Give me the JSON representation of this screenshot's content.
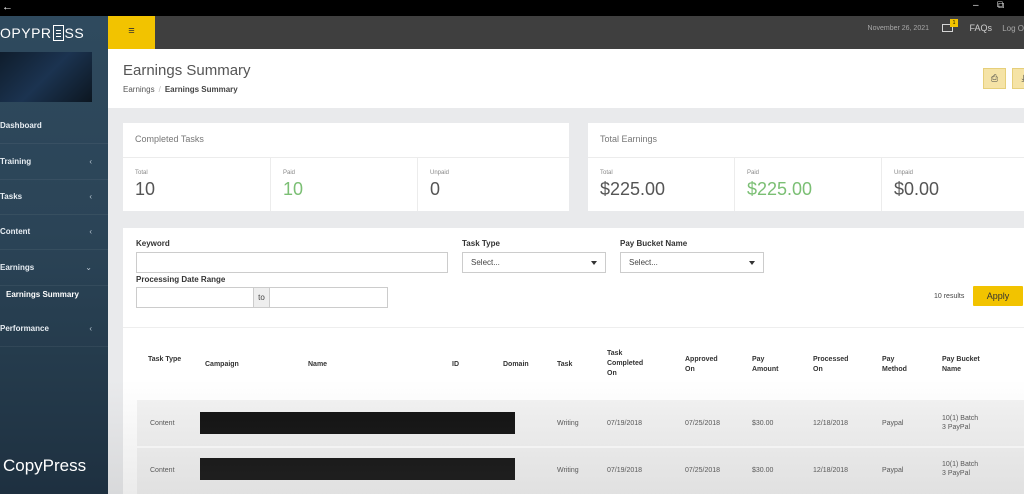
{
  "brand": {
    "logo_left": "OPYPR",
    "logo_right": "SS",
    "bottom_text": "CopyPress"
  },
  "window": {
    "back_glyph": "←",
    "minimize_glyph": "–",
    "restore_glyph": "⧉"
  },
  "sidebar": {
    "items": [
      {
        "label": "Dashboard",
        "chevron": ""
      },
      {
        "label": "Training",
        "chevron": "‹"
      },
      {
        "label": "Tasks",
        "chevron": "‹"
      },
      {
        "label": "Content",
        "chevron": "‹"
      },
      {
        "label": "Earnings",
        "chevron": "⌄"
      },
      {
        "label": "Performance",
        "chevron": "‹"
      }
    ],
    "sub_item": "Earnings Summary"
  },
  "topbar": {
    "menu_glyph": "≡",
    "date": "November 26, 2021",
    "mail_badge": "1",
    "faqs": "FAQs",
    "logout": "Log O"
  },
  "header": {
    "title": "Earnings Summary",
    "breadcrumb_root": "Earnings",
    "breadcrumb_sep": "/",
    "breadcrumb_current": "Earnings Summary",
    "print_glyph": "⎙",
    "export_glyph": "⤓"
  },
  "completed_tasks": {
    "title": "Completed Tasks",
    "stats": [
      {
        "label": "Total",
        "value": "10"
      },
      {
        "label": "Paid",
        "value": "10"
      },
      {
        "label": "Unpaid",
        "value": "0"
      }
    ]
  },
  "total_earnings": {
    "title": "Total Earnings",
    "stats": [
      {
        "label": "Total",
        "value": "$225.00"
      },
      {
        "label": "Paid",
        "value": "$225.00"
      },
      {
        "label": "Unpaid",
        "value": "$0.00"
      }
    ]
  },
  "filters": {
    "keyword_label": "Keyword",
    "task_type_label": "Task Type",
    "task_type_value": "Select...",
    "pay_bucket_label": "Pay Bucket Name",
    "pay_bucket_value": "Select...",
    "date_range_label": "Processing Date Range",
    "to_label": "to",
    "results": "10 results",
    "apply": "Apply"
  },
  "table": {
    "headers": {
      "task_type": "Task Type",
      "campaign": "Campaign",
      "name": "Name",
      "id": "ID",
      "domain": "Domain",
      "task": "Task",
      "task_completed_on": "Task Completed On",
      "approved_on": "Approved On",
      "pay_amount": "Pay Amount",
      "processed_on": "Processed On",
      "pay_method": "Pay Method",
      "pay_bucket_name": "Pay Bucket Name"
    },
    "rows": [
      {
        "task_type": "Content",
        "task": "Writing",
        "completed": "07/19/2018",
        "approved": "07/25/2018",
        "amount": "$30.00",
        "processed": "12/18/2018",
        "method": "Paypal",
        "bucket": "10(1) Batch 3 PayPal"
      },
      {
        "task_type": "Content",
        "task": "Writing",
        "completed": "07/19/2018",
        "approved": "07/25/2018",
        "amount": "$30.00",
        "processed": "12/18/2018",
        "method": "Paypal",
        "bucket": "10(1) Batch 3 PayPal"
      }
    ]
  },
  "colors": {
    "accent": "#f2c300",
    "sidebar": "#2b4457",
    "paid_green": "#7bbf74"
  }
}
